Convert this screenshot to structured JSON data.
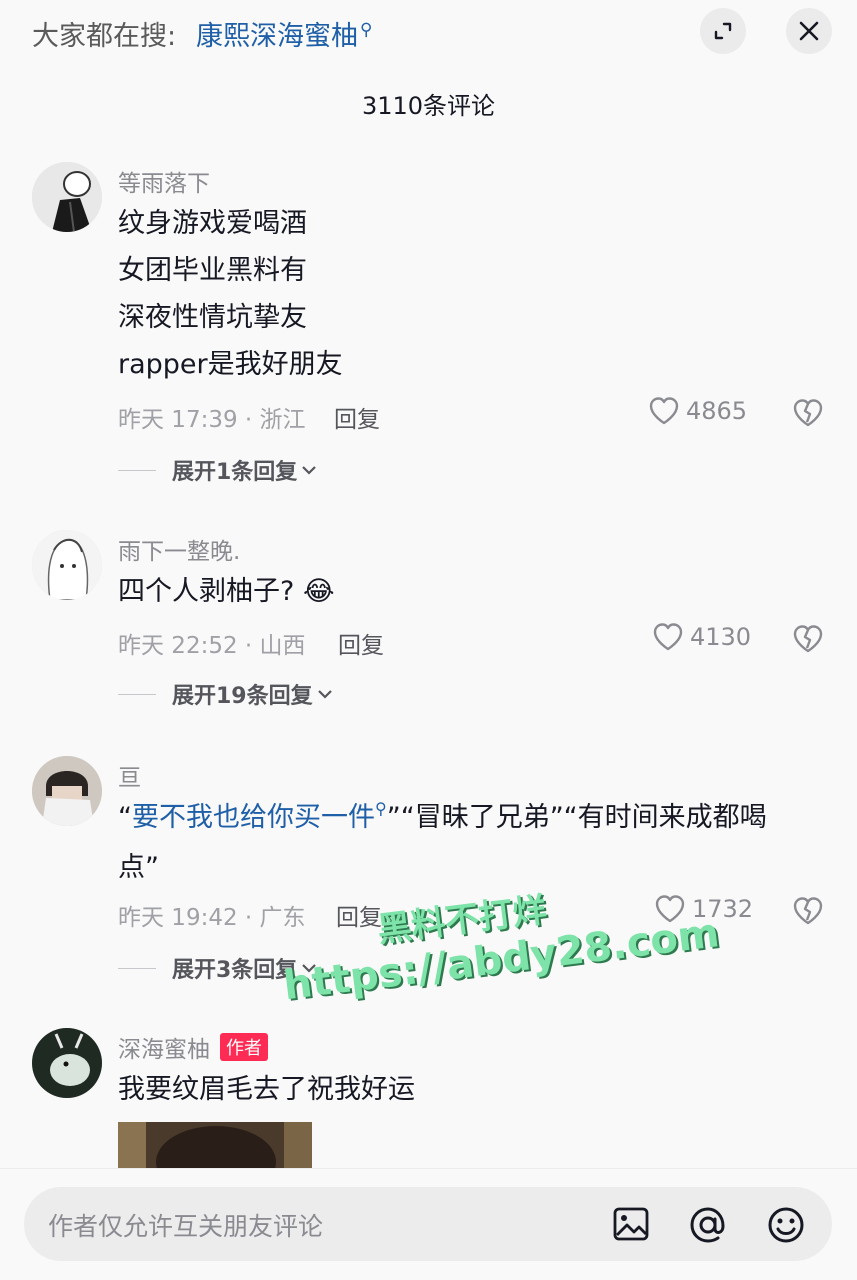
{
  "topbar": {
    "search_prefix": "大家都在搜:",
    "search_term": "康熙深海蜜柚",
    "search_glyph": "⚲"
  },
  "comment_count": "3110条评论",
  "comments": [
    {
      "username": "等雨落下",
      "lines": [
        "纹身游戏爱喝酒",
        "女团毕业黑料有",
        "深夜性情坑挚友",
        "rapper是我好朋友"
      ],
      "meta": "昨天 17:39 · 浙江",
      "reply_label": "回复",
      "likes": "4865",
      "expand_label": "展开1条回复"
    },
    {
      "username": "雨下一整晚.",
      "lines": [
        "四个人剥柚子?"
      ],
      "emoji": "😂",
      "meta": "昨天 22:52 · 山西",
      "reply_label": "回复",
      "likes": "4130",
      "expand_label": "展开19条回复"
    },
    {
      "username": "亘",
      "line1_link": "要不我也给你买一件",
      "line1_quote_open": "“",
      "line1_rest": "”“冒昧了兄弟”“有时间来成都喝",
      "line2": "点”",
      "meta": "昨天 19:42 · 广东",
      "reply_label": "回复",
      "likes": "1732",
      "expand_label": "展开3条回复"
    },
    {
      "username": "深海蜜柚",
      "badge": "作者",
      "lines": [
        "我要纹眉毛去了祝我好运"
      ]
    }
  ],
  "watermark": {
    "line1": "黑料不打烊",
    "line2": "https://abdy28.com"
  },
  "input": {
    "placeholder": "作者仅允许互关朋友评论"
  },
  "icons": {
    "expand": "expand-icon",
    "close": "close-icon",
    "like": "heart-icon",
    "dislike": "broken-heart-icon",
    "image": "image-icon",
    "at": "at-icon",
    "emoji": "smiley-icon"
  }
}
